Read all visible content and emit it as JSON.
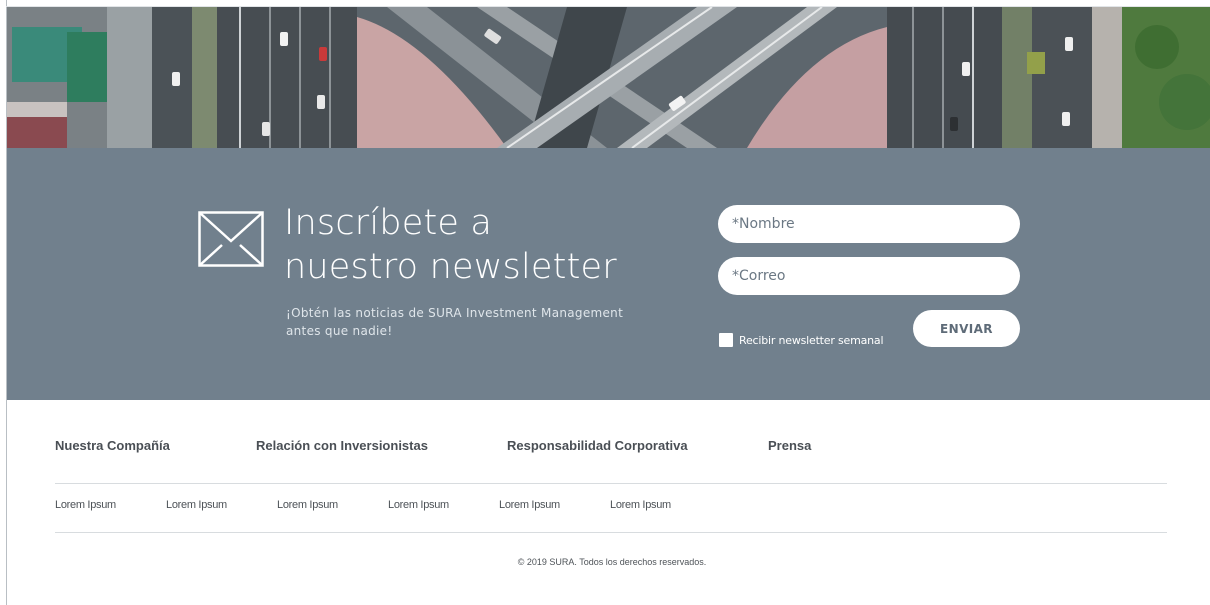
{
  "hero": {
    "image_description_icon": "aerial-highway-image"
  },
  "newsletter": {
    "title_line1": "Inscríbete a",
    "title_line2": "nuestro newsletter",
    "subtitle_line1": "¡Obtén las noticias de SURA Investment Management",
    "subtitle_line2": "antes que nadie!",
    "name_placeholder": "*Nombre",
    "email_placeholder": "*Correo",
    "checkbox_label": "Recibir newsletter semanal",
    "send_label": "ENVIAR",
    "icon": "envelope-icon",
    "background_color": "#71808d"
  },
  "footer": {
    "nav": [
      {
        "label": "Nuestra Compañía"
      },
      {
        "label": "Relación con Inversionistas"
      },
      {
        "label": "Responsabilidad Corporativa"
      },
      {
        "label": "Prensa"
      }
    ],
    "links": [
      {
        "label": "Lorem Ipsum"
      },
      {
        "label": "Lorem Ipsum"
      },
      {
        "label": "Lorem Ipsum"
      },
      {
        "label": "Lorem Ipsum"
      },
      {
        "label": "Lorem Ipsum"
      },
      {
        "label": "Lorem Ipsum"
      }
    ],
    "copyright": "© 2019 SURA. Todos los derechos reservados."
  }
}
